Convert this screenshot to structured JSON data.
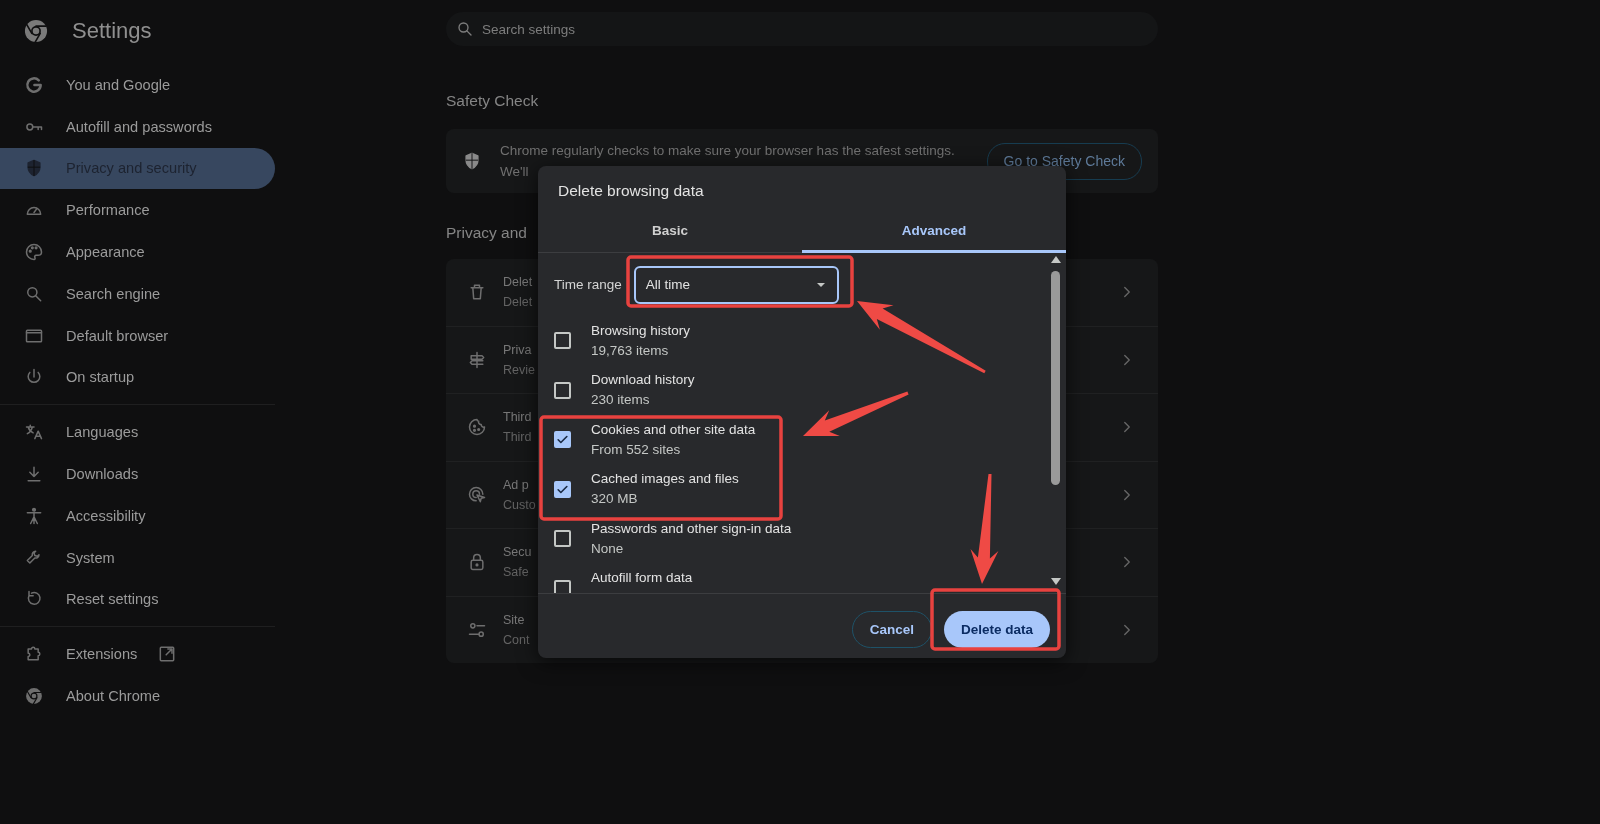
{
  "sidebar": {
    "title": "Settings",
    "groups": [
      {
        "items": [
          {
            "label": "You and Google",
            "selected": false
          },
          {
            "label": "Autofill and passwords",
            "selected": false
          },
          {
            "label": "Privacy and security",
            "selected": true
          },
          {
            "label": "Performance",
            "selected": false
          },
          {
            "label": "Appearance",
            "selected": false
          },
          {
            "label": "Search engine",
            "selected": false
          },
          {
            "label": "Default browser",
            "selected": false
          },
          {
            "label": "On startup",
            "selected": false
          }
        ]
      },
      {
        "items": [
          {
            "label": "Languages",
            "selected": false
          },
          {
            "label": "Downloads",
            "selected": false
          },
          {
            "label": "Accessibility",
            "selected": false
          },
          {
            "label": "System",
            "selected": false
          },
          {
            "label": "Reset settings",
            "selected": false
          }
        ]
      },
      {
        "items": [
          {
            "label": "Extensions",
            "selected": false
          },
          {
            "label": "About Chrome",
            "selected": false
          }
        ]
      }
    ]
  },
  "search": {
    "placeholder": "Search settings"
  },
  "safety_check": {
    "heading": "Safety Check",
    "lines": [
      "Chrome regularly checks to make sure your browser has the safest settings.",
      "We'll"
    ],
    "button": "Go to Safety Check"
  },
  "privacy": {
    "heading": "Privacy and",
    "rows": [
      {
        "title": "Delet",
        "subtitle": "Delet"
      },
      {
        "title": "Priva",
        "subtitle": "Revie"
      },
      {
        "title": "Third",
        "subtitle": "Third"
      },
      {
        "title": "Ad p",
        "subtitle": "Custo"
      },
      {
        "title": "Secu",
        "subtitle": "Safe"
      },
      {
        "title": "Site",
        "subtitle": "Cont"
      }
    ]
  },
  "dialog": {
    "title": "Delete browsing data",
    "tabs": [
      {
        "label": "Basic",
        "selected": false
      },
      {
        "label": "Advanced",
        "selected": true
      }
    ],
    "time_range": {
      "label": "Time range",
      "value": "All time"
    },
    "options": [
      {
        "label": "Browsing history",
        "detail": "19,763 items",
        "checked": false
      },
      {
        "label": "Download history",
        "detail": "230 items",
        "checked": false
      },
      {
        "label": "Cookies and other site data",
        "detail": "From 552 sites",
        "checked": true
      },
      {
        "label": "Cached images and files",
        "detail": "320 MB",
        "checked": true
      },
      {
        "label": "Passwords and other sign-in data",
        "detail": "None",
        "checked": false
      },
      {
        "label": "Autofill form data",
        "checked": false
      }
    ],
    "buttons": [
      {
        "label": "Cancel",
        "kind": "secondary"
      },
      {
        "label": "Delete data",
        "kind": "primary"
      }
    ]
  }
}
